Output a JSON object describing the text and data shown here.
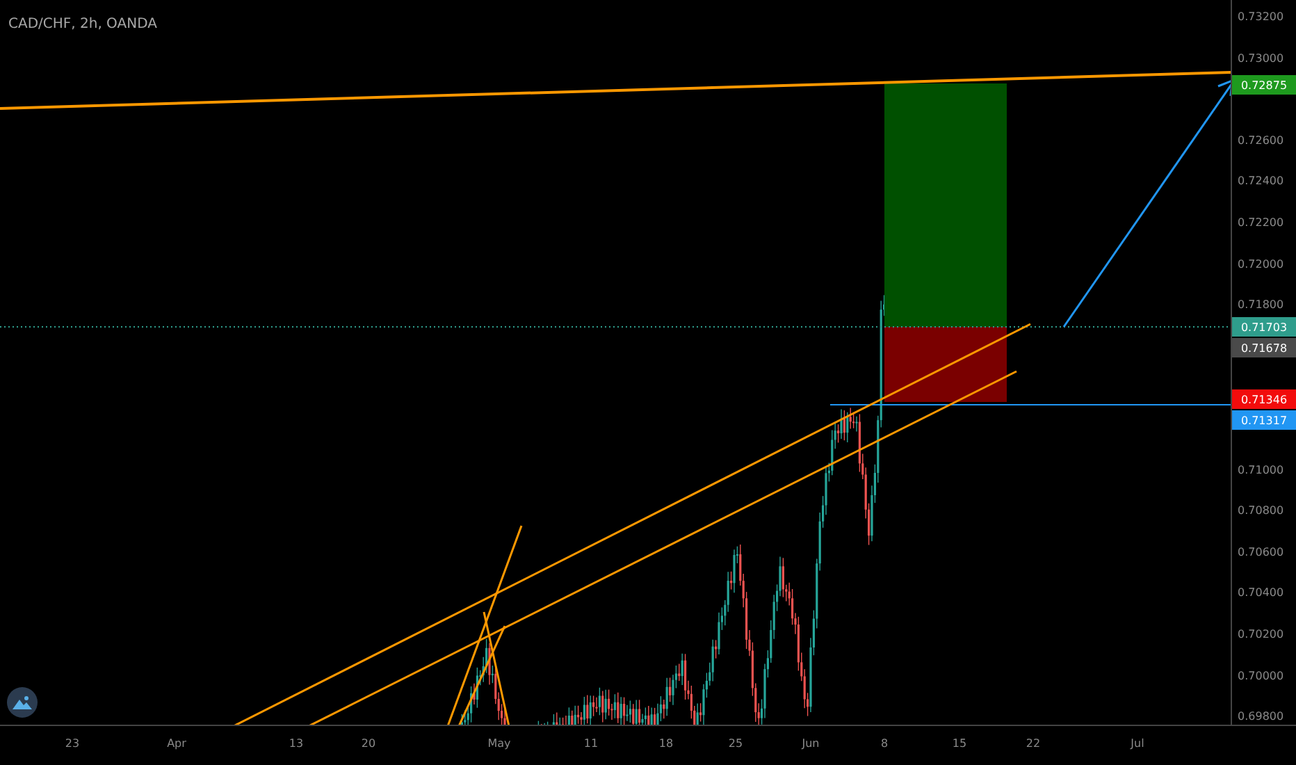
{
  "title": "CAD/CHF, 2h, OANDA",
  "price_axis": {
    "ticks": [
      "0.73200",
      "0.73000",
      "0.72600",
      "0.72400",
      "0.72200",
      "0.72000",
      "0.71800",
      "0.71000",
      "0.70800",
      "0.70600",
      "0.70400",
      "0.70200",
      "0.70000",
      "0.69800"
    ],
    "badges": [
      {
        "label": "0.72875",
        "color": "#1e9a1e"
      },
      {
        "label": "0.71703",
        "color": "#2f9d8c"
      },
      {
        "label": "0.71678",
        "color": "#4a4a4a"
      },
      {
        "label": "0.71346",
        "color": "#f20c0c"
      },
      {
        "label": "0.71317",
        "color": "#2196f3"
      }
    ]
  },
  "time_axis": [
    "23",
    "Apr",
    "13",
    "20",
    "May",
    "11",
    "18",
    "25",
    "Jun",
    "8",
    "15",
    "22",
    "Jul"
  ]
}
